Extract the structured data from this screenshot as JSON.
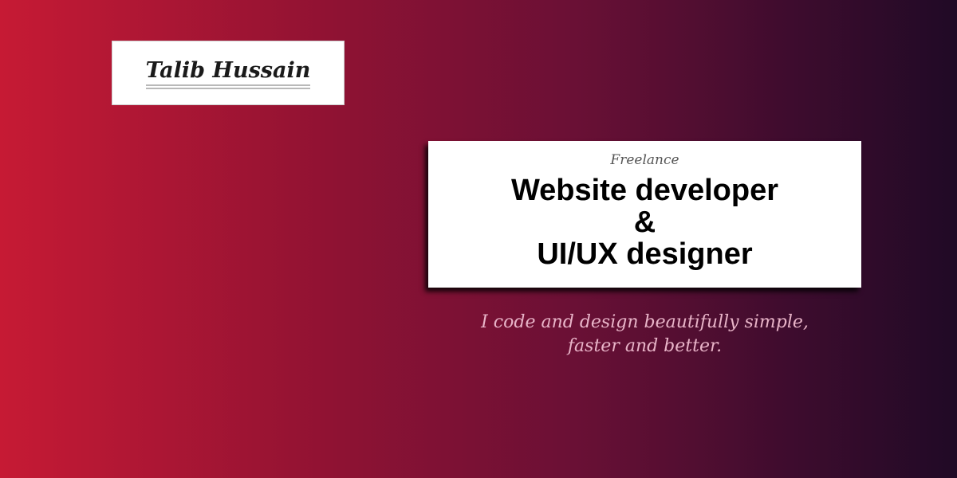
{
  "brand": {
    "name": "Talib Hussain"
  },
  "hero": {
    "kicker": "Freelance",
    "title_line1": "Website developer",
    "title_line2": "&",
    "title_line3": "UI/UX designer"
  },
  "tagline": {
    "line1": "I code and design beautifully simple,",
    "line2": "faster and better."
  },
  "colors": {
    "gradient_start": "#c61a34",
    "gradient_end": "#200a26",
    "card_background": "#ffffff",
    "tagline_text": "#e8b4c8"
  }
}
